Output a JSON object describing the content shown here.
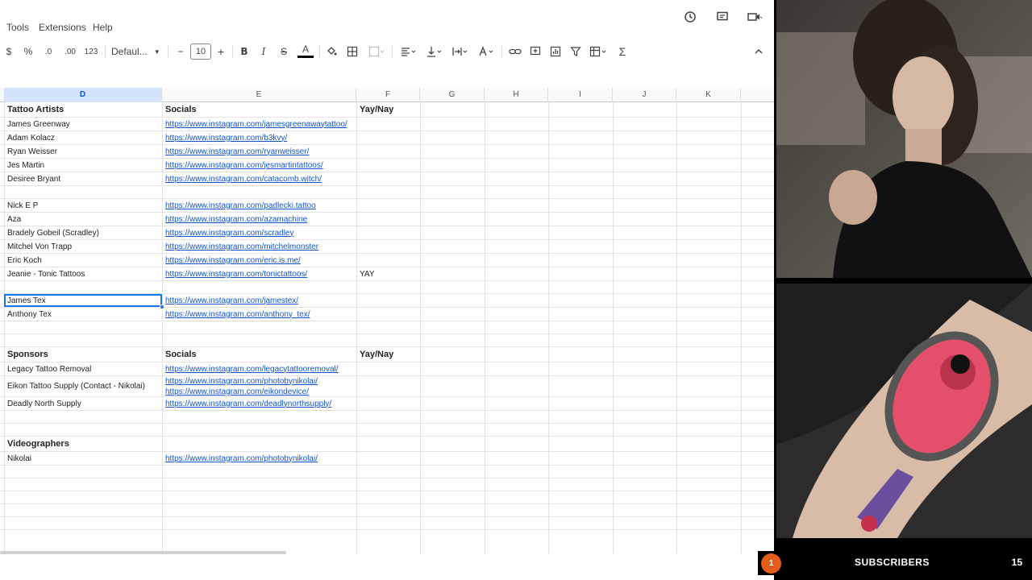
{
  "menu": [
    "Tools",
    "Extensions",
    "Help"
  ],
  "toolbar": {
    "currency": "$",
    "percent": "%",
    "dec_decrease": ".0",
    "dec_increase": ".00",
    "format_123": "123",
    "font": "Defaul...",
    "font_size": "10",
    "minus": "−",
    "plus": "+",
    "bold": "B",
    "italic": "I",
    "strike": "S",
    "text_color": "A",
    "sum": "Σ"
  },
  "columns": [
    "D",
    "E",
    "F",
    "G",
    "H",
    "I",
    "J",
    "K"
  ],
  "rows": [
    {
      "d": "Tattoo Artists",
      "e": "Socials",
      "f": "Yay/Nay",
      "header": true
    },
    {
      "d": "James Greenway",
      "e": "https://www.instagram.com/jamesgreenawaytattoo/",
      "f": ""
    },
    {
      "d": "Adam Kolacz",
      "e": "https://www.instagram.com/b3kvy/",
      "f": ""
    },
    {
      "d": "Ryan Weisser",
      "e": "https://www.instagram.com/ryanweisser/",
      "f": ""
    },
    {
      "d": "Jes Martin",
      "e": "https://www.instagram.com/jesmartintattoos/",
      "f": ""
    },
    {
      "d": "Desiree Bryant",
      "e": "https://www.instagram.com/catacomb.witch/",
      "f": ""
    },
    {
      "d": "",
      "e": "",
      "f": ""
    },
    {
      "d": "Nick E P",
      "e": "https://www.instagram.com/padlecki.tattoo",
      "f": ""
    },
    {
      "d": "Aza",
      "e": "https://www.instagram.com/azamachine",
      "f": ""
    },
    {
      "d": "Bradely Gobeil (Scradley)",
      "e": "https://www.instagram.com/scradley",
      "f": ""
    },
    {
      "d": "Mitchel Von Trapp",
      "e": "https://www.instagram.com/mitchelmonster",
      "f": ""
    },
    {
      "d": "Eric Koch",
      "e": "https://www.instagram.com/eric.is.me/",
      "f": ""
    },
    {
      "d": "Jeanie - Tonic Tattoos",
      "e": "https://www.instagram.com/tonictattoos/",
      "f": "YAY"
    },
    {
      "d": "",
      "e": "",
      "f": ""
    },
    {
      "d": "James Tex",
      "e": "https://www.instagram.com/jamestex/",
      "f": "",
      "selected": true
    },
    {
      "d": "Anthony Tex",
      "e": "https://www.instagram.com/anthony_tex/",
      "f": ""
    },
    {
      "d": "",
      "e": "",
      "f": ""
    },
    {
      "d": "",
      "e": "",
      "f": ""
    },
    {
      "d": "Sponsors",
      "e": "Socials",
      "f": "Yay/Nay",
      "header": true
    },
    {
      "d": "Legacy Tattoo Removal",
      "e": "https://www.instagram.com/legacytattooremoval/",
      "f": ""
    },
    {
      "d": "Eikon Tattoo Supply (Contact - Nikolai)",
      "e": "https://www.instagram.com/photobynikolai/",
      "e2": "https://www.instagram.com/eikondevice/",
      "f": ""
    },
    {
      "d": "Deadly North Supply",
      "e": "https://www.instagram.com/deadlynorthsupply/",
      "f": ""
    },
    {
      "d": "",
      "e": "",
      "f": ""
    },
    {
      "d": "",
      "e": "",
      "f": ""
    },
    {
      "d": "Videographers",
      "e": "",
      "f": "",
      "header": true
    },
    {
      "d": "Nikolai",
      "e": "https://www.instagram.com/photobynikolai/",
      "f": ""
    },
    {
      "d": "",
      "e": "",
      "f": ""
    },
    {
      "d": "",
      "e": "",
      "f": ""
    },
    {
      "d": "",
      "e": "",
      "f": ""
    },
    {
      "d": "",
      "e": "",
      "f": ""
    },
    {
      "d": "",
      "e": "",
      "f": ""
    }
  ],
  "subscribers": {
    "badge": "1",
    "label": "SUBSCRIBERS",
    "count": "15"
  },
  "colors": {
    "link": "#1155cc",
    "selection": "#1a73e8",
    "active_header": "#d3e3fd",
    "sub_badge": "#e25d1b"
  }
}
